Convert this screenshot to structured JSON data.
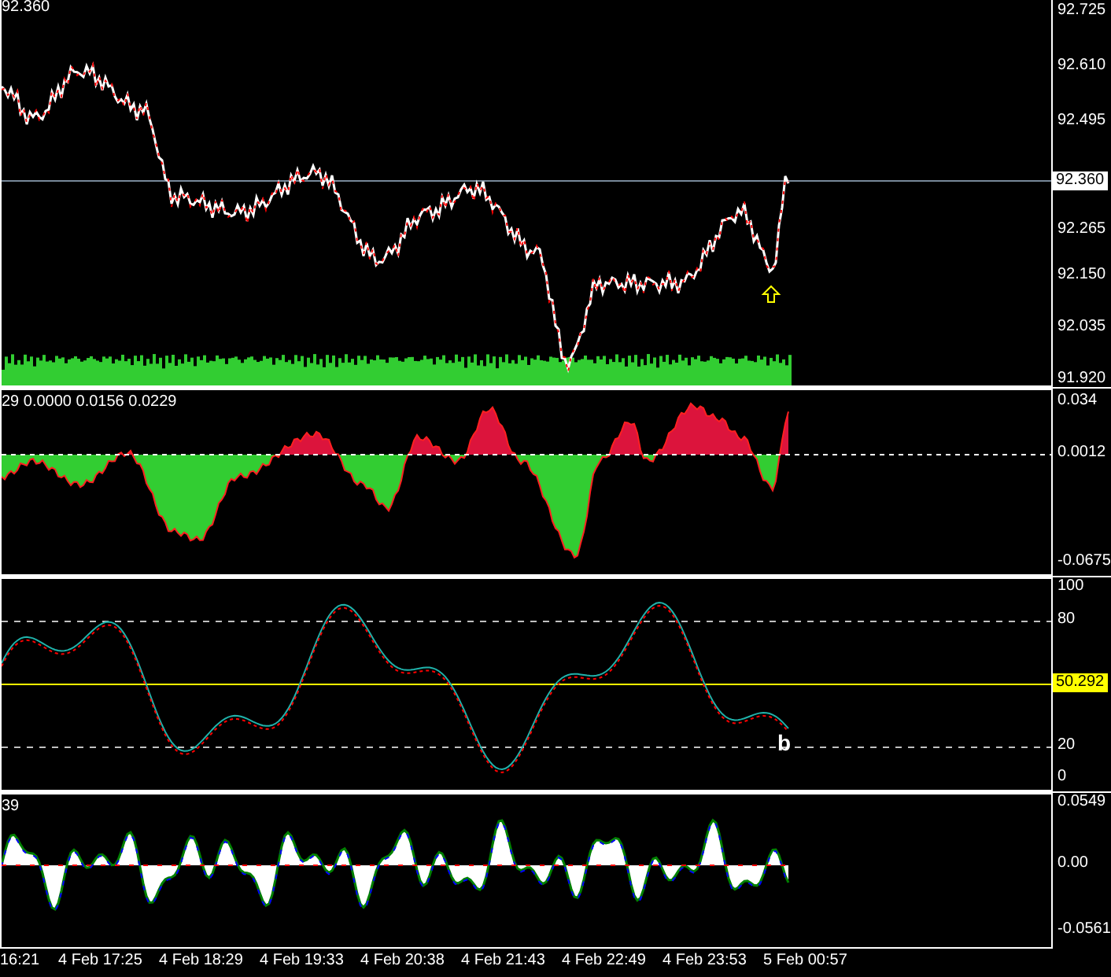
{
  "price_chart": {
    "top_label": "92.360",
    "price_ticks": [
      "92.725",
      "92.610",
      "92.495",
      "92.265",
      "92.150",
      "92.035",
      "91.920"
    ],
    "current_price": "92.360"
  },
  "oscillator_panel": {
    "legend": "29 0.0000 0.0156 0.0229",
    "ticks": [
      "0.034",
      "0.0012",
      "-0.0675"
    ]
  },
  "stochastic_panel": {
    "ticks": [
      "100",
      "80",
      "20",
      "0"
    ],
    "current_value": "50.292",
    "marker": "b"
  },
  "histogram_panel": {
    "legend": "39",
    "ticks": [
      "0.0549",
      "0.00",
      "-0.0561"
    ]
  },
  "time_axis": [
    "16:21",
    "4 Feb 17:25",
    "4 Feb 18:29",
    "4 Feb 19:33",
    "4 Feb 20:38",
    "4 Feb 21:43",
    "4 Feb 22:49",
    "4 Feb 23:53",
    "5 Feb 00:57"
  ]
}
